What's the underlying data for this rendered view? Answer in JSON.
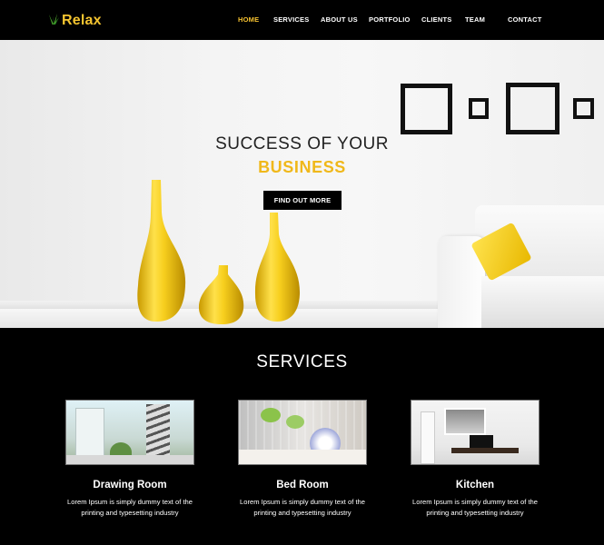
{
  "header": {
    "logo_text": "Relax",
    "nav": [
      {
        "label": "HOME",
        "active": true
      },
      {
        "label": "SERVICES",
        "active": false
      },
      {
        "label": "ABOUT US",
        "active": false
      },
      {
        "label": "PORTFOLIO",
        "active": false
      },
      {
        "label": "CLIENTS",
        "active": false
      },
      {
        "label": "TEAM",
        "active": false
      },
      {
        "label": "CONTACT",
        "active": false
      }
    ]
  },
  "hero": {
    "title": "SUCCESS OF YOUR",
    "accent": "BUSINESS",
    "button_label": "FIND OUT MORE"
  },
  "services": {
    "title": "SERVICES",
    "cards": [
      {
        "title": "Drawing Room",
        "text": "Lorem Ipsum is simply dummy text of the printing and typesetting industry"
      },
      {
        "title": "Bed Room",
        "text": "Lorem Ipsum is simply dummy text of the printing and typesetting industry"
      },
      {
        "title": "Kitchen",
        "text": "Lorem Ipsum is simply dummy text of the printing and typesetting industry"
      }
    ]
  },
  "colors": {
    "accent": "#f0b81a",
    "background": "#000000"
  }
}
